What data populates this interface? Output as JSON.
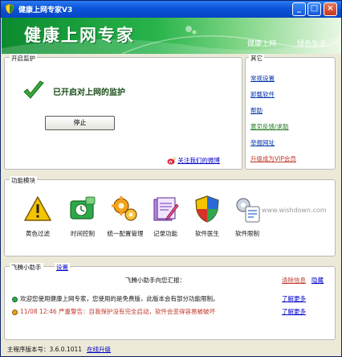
{
  "window": {
    "title": "健康上网专家V3"
  },
  "banner": {
    "brand": "健康上网专家",
    "slogan_1": "健康上网",
    "slogan_2": "绿色生活"
  },
  "monitor": {
    "section_title": "开启监护",
    "status_text": "已开启对上网的监护",
    "stop_button": "停止",
    "follow_link": "关注我们的微博"
  },
  "other": {
    "section_title": "其它",
    "links": [
      "常规设置",
      "卸载软件",
      "帮助",
      "意见反馈/求助",
      "举报网址",
      "升级成为VIP会员"
    ]
  },
  "modules": {
    "section_title": "功能模块",
    "items": [
      "黄色过滤",
      "时间控制",
      "统一配置管理",
      "记录功能",
      "软件医生",
      "软件限制"
    ],
    "watermark": "www.wishdown.com"
  },
  "assistant": {
    "section_title": "飞腾小助手",
    "settings_link": "设置",
    "report_title": "飞腾小助手向您汇报：",
    "clear_link": "清除信息",
    "hide_link": "隐藏",
    "messages": [
      "欢迎您使用健康上网专家，您使用的是免费版，此版本会有部分功能限制。",
      "11/08 12:46 严重警告：自我保护没有完全启动，软件会变得容易被破坏"
    ],
    "more_link": "了解更多"
  },
  "footer": {
    "version_label": "主程序版本号：3.6.0.1011",
    "upgrade_link": "在线升级"
  },
  "colors": {
    "banner_green": "#1fa445",
    "link_blue": "#0000cc",
    "warning_red": "#c0392b"
  }
}
